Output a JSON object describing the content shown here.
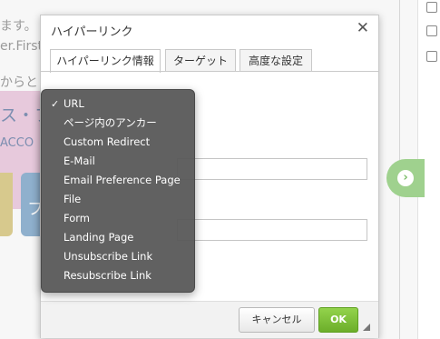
{
  "background": {
    "line1": "ます。",
    "line2": "er.First",
    "line3": "からと",
    "banner_text": "ス・フ",
    "banner_sub": "ACCO",
    "bottom_glyph": "フ"
  },
  "dialog": {
    "title": "ハイパーリンク",
    "close_glyph": "✕",
    "tabs": [
      {
        "label": "ハイパーリンク情報",
        "active": true
      },
      {
        "label": "ターゲット",
        "active": false
      },
      {
        "label": "高度な設定",
        "active": false
      }
    ],
    "cancel_label": "キャンセル",
    "ok_label": "OK"
  },
  "dropdown": {
    "selected": "URL",
    "check_glyph": "✓",
    "options": [
      "URL",
      "ページ内のアンカー",
      "Custom Redirect",
      "E-Mail",
      "Email Preference Page",
      "File",
      "Form",
      "Landing Page",
      "Unsubscribe Link",
      "Resubscribe Link"
    ]
  },
  "nav_arrow_glyph": "›",
  "colors": {
    "ok_green": "#6cae2a",
    "nav_green": "#9fd18e",
    "dropdown_bg": "#585858"
  }
}
